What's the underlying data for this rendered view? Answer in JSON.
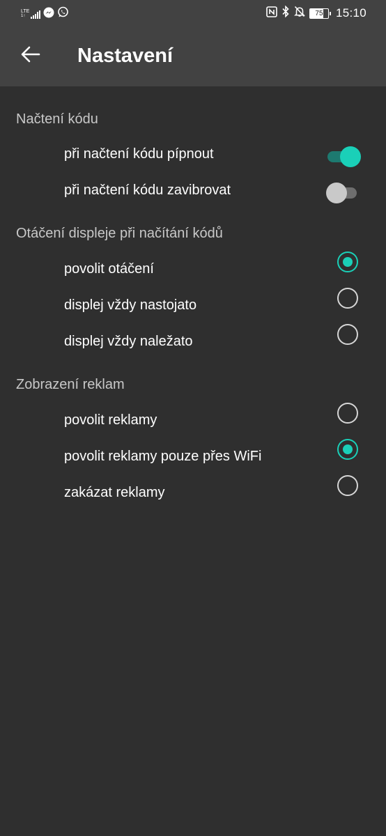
{
  "status_bar": {
    "network": "LTE",
    "network_sub": "1↑",
    "battery": "75",
    "battery_level_percent": 75,
    "time": "15:10",
    "icons": [
      "signal-icon",
      "messenger-icon",
      "whatsapp-icon",
      "nfc-icon",
      "bluetooth-icon",
      "bell-off-icon",
      "battery-icon"
    ]
  },
  "toolbar": {
    "title": "Nastavení",
    "back_icon": "arrow-left-icon"
  },
  "sections": {
    "scan": {
      "title": "Načtení kódu",
      "items": [
        {
          "label": "při načtení kódu pípnout",
          "on": true
        },
        {
          "label": "při načtení kódu zavibrovat",
          "on": false
        }
      ]
    },
    "rotation": {
      "title": "Otáčení displeje při načítání kódů",
      "options": [
        {
          "label": "povolit otáčení",
          "selected": true
        },
        {
          "label": "displej vždy nastojato",
          "selected": false
        },
        {
          "label": "displej vždy naležato",
          "selected": false
        }
      ]
    },
    "ads": {
      "title": "Zobrazení reklam",
      "options": [
        {
          "label": "povolit reklamy",
          "selected": false
        },
        {
          "label": "povolit reklamy pouze přes WiFi",
          "selected": true
        },
        {
          "label": "zakázat reklamy",
          "selected": false
        }
      ]
    }
  },
  "colors": {
    "accent": "#1ad0b8",
    "accent_track": "#1d7a70",
    "background": "#2f2f2f",
    "toolbar": "#424242"
  }
}
